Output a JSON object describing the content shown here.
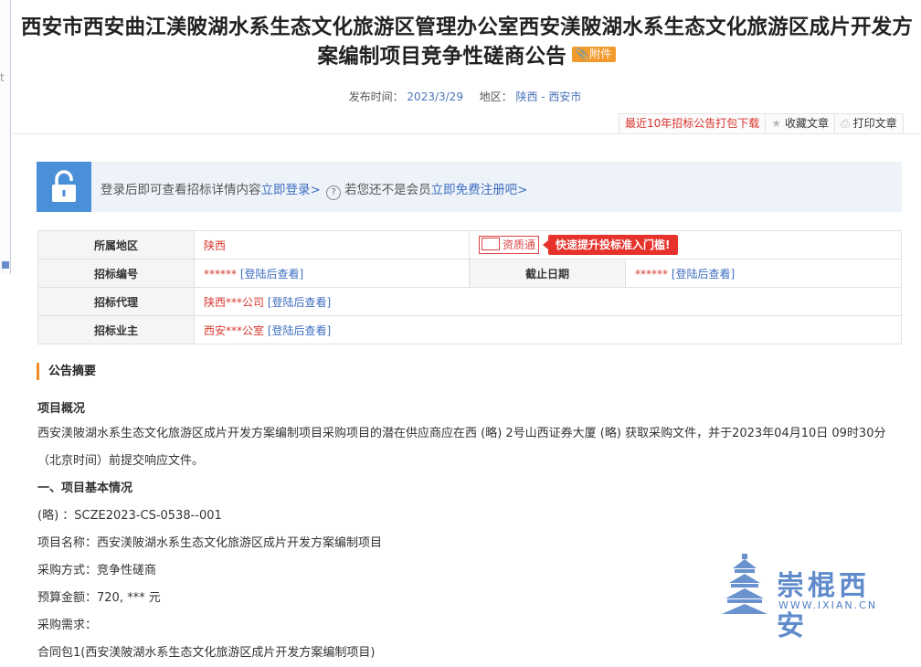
{
  "left_marker": "t",
  "title": "西安市西安曲江渼陂湖水系生态文化旅游区管理办公室西安渼陂湖水系生态文化旅游区成片开发方案编制项目竞争性磋商公告",
  "attachment_badge": "附件",
  "meta": {
    "publish_label": "发布时间：",
    "publish_date": "2023/3/29",
    "region_label": "地区：",
    "region_value": "陕西 - 西安市"
  },
  "toolbar": {
    "download": "最近10年招标公告打包下载",
    "favorite": "收藏文章",
    "print": "打印文章"
  },
  "login_bar": {
    "text1": "登录后即可查看招标详情内容",
    "login_link": "立即登录>",
    "text2": "若您还不是会员",
    "register_link": "立即免费注册吧>"
  },
  "info_table": {
    "region_label": "所属地区",
    "region_value": "陕西",
    "zzt_label": "资质通",
    "zzt_tip": "快速提升投标准入门槛!",
    "bid_no_label": "招标编号",
    "bid_no_value": "******",
    "deadline_label": "截止日期",
    "deadline_value": "******",
    "agent_label": "招标代理",
    "agent_value": "陕西***公司",
    "owner_label": "招标业主",
    "owner_value": "西安***公室",
    "login_to_view": "[登陆后查看]"
  },
  "summary": {
    "heading": "公告摘要",
    "overview_heading": "项目概况",
    "overview_text": "西安渼陂湖水系生态文化旅游区成片开发方案编制项目采购项目的潜在供应商应在西 (略) 2号山西证券大厦 (略) 获取采购文件，并于2023年04月10日 09时30分（北京时间）前提交响应文件。",
    "section1_heading": "一、项目基本情况",
    "project_no": "(略) ：SCZE2023-CS-0538--001",
    "project_name": "项目名称：西安渼陂湖水系生态文化旅游区成片开发方案编制项目",
    "procurement_method": "采购方式：竞争性磋商",
    "budget": "预算金额：720, *** 元",
    "requirement": "采购需求：",
    "cutoff_line": "合同包1(西安渼陂湖水系生态文化旅游区成片开发方案编制项目)"
  },
  "watermark": {
    "name": "崇棍西安",
    "url": "WWW.IXIAN.CN"
  },
  "colors": {
    "link_blue": "#3f6fc0",
    "red": "#d73a32",
    "accent_orange": "#f08a24",
    "lock_blue": "#4a90d9"
  }
}
